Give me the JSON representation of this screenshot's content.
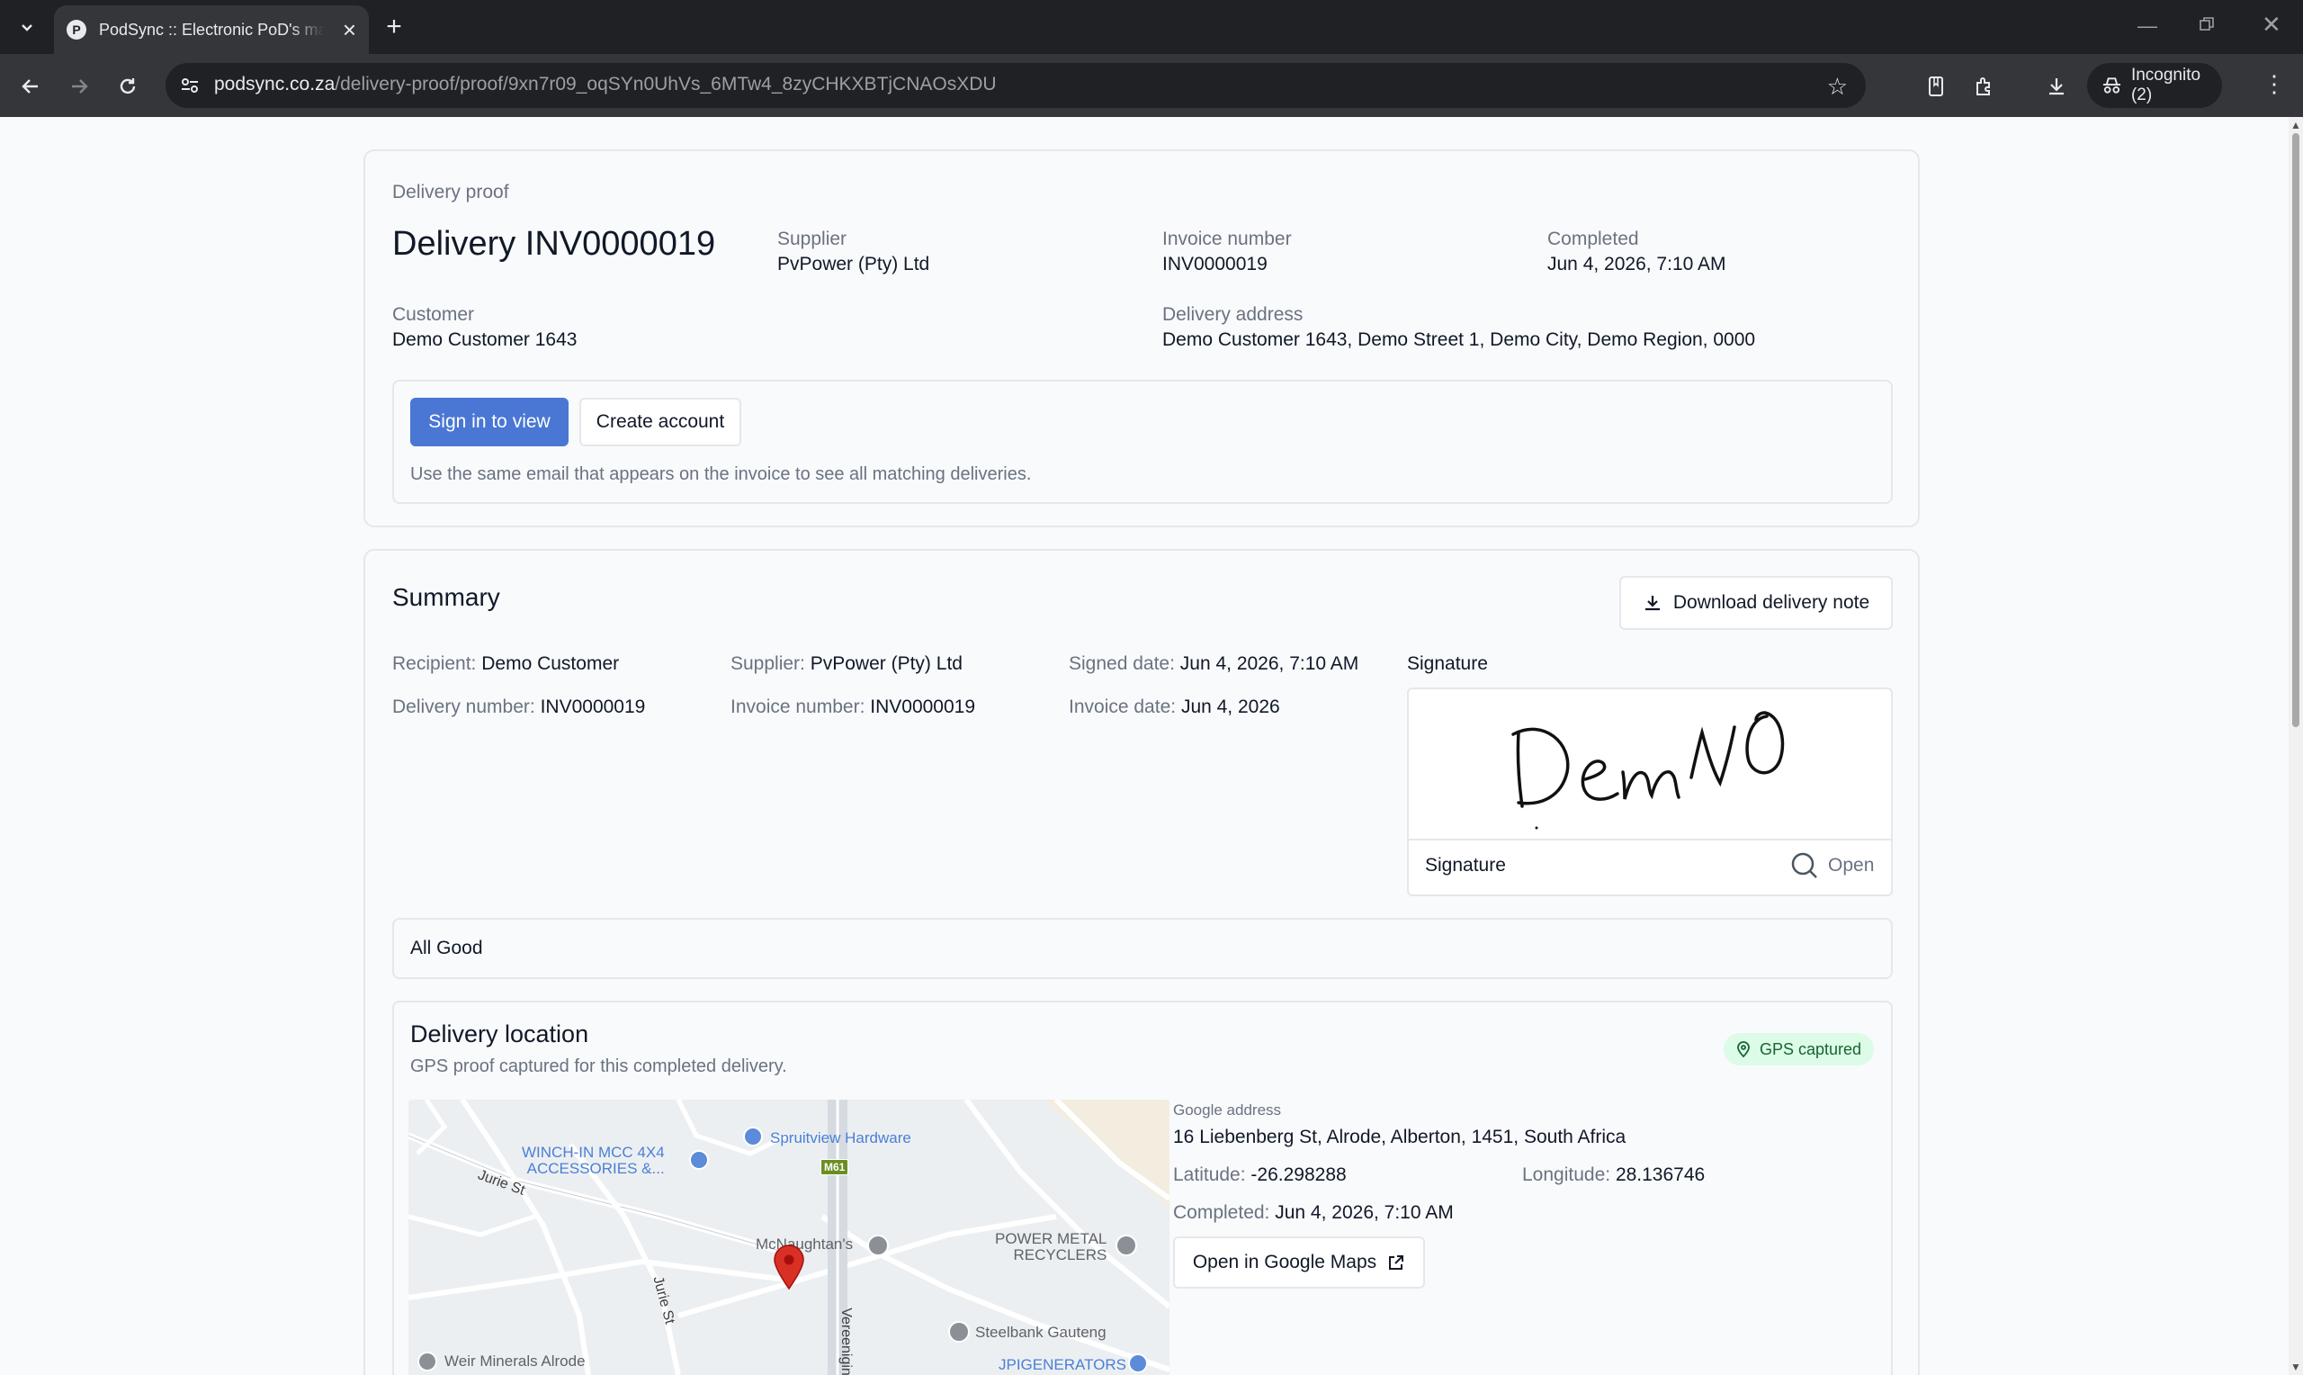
{
  "browser": {
    "tab_title": "PodSync :: Electronic PoD's made simple",
    "favicon_letter": "P",
    "url_host": "podsync.co.za",
    "url_path": "/delivery-proof/proof/9xn7r09_oqSYn0UhVs_6MTw4_8zyCHKXBTjCNAOsXDU",
    "incognito_label": "Incognito (2)"
  },
  "header_card": {
    "eyebrow": "Delivery proof",
    "title": "Delivery INV0000019",
    "supplier_label": "Supplier",
    "supplier_value": "PvPower (Pty) Ltd",
    "invoice_label": "Invoice number",
    "invoice_value": "INV0000019",
    "completed_label": "Completed",
    "completed_value": "Jun 4, 2026, 7:10 AM",
    "customer_label": "Customer",
    "customer_value": "Demo Customer 1643",
    "address_label": "Delivery address",
    "address_value": "Demo Customer 1643, Demo Street 1, Demo City, Demo Region, 0000",
    "sign_in_label": "Sign in to view",
    "create_account_label": "Create account",
    "hint": "Use the same email that appears on the invoice to see all matching deliveries."
  },
  "summary": {
    "title": "Summary",
    "download_label": "Download delivery note",
    "recipient_label": "Recipient:",
    "recipient_value": "Demo Customer",
    "supplier_label": "Supplier:",
    "supplier_value": "PvPower (Pty) Ltd",
    "signed_label": "Signed date:",
    "signed_value": "Jun 4, 2026, 7:10 AM",
    "delivery_no_label": "Delivery number:",
    "delivery_no_value": "INV0000019",
    "invoice_no_label": "Invoice number:",
    "invoice_no_value": "INV0000019",
    "invoice_date_label": "Invoice date:",
    "invoice_date_value": "Jun 4, 2026",
    "signature_heading": "Signature",
    "signature_caption": "Signature",
    "signature_open": "Open",
    "note": "All Good"
  },
  "location": {
    "title": "Delivery location",
    "subtitle": "GPS proof captured for this completed delivery.",
    "badge": "GPS captured",
    "google_address_label": "Google address",
    "google_address_value": "16 Liebenberg St, Alrode, Alberton, 1451, South Africa",
    "lat_label": "Latitude:",
    "lat_value": "-26.298288",
    "lng_label": "Longitude:",
    "lng_value": "28.136746",
    "completed_label": "Completed:",
    "completed_value": "Jun 4, 2026, 7:10 AM",
    "open_maps_label": "Open in Google Maps",
    "map": {
      "poi_winch_1": "WINCH-IN MCC 4X4",
      "poi_winch_2": "ACCESSORIES &...",
      "poi_spruitview": "Spruitview Hardware",
      "road_m61": "M61",
      "road_jurie_1": "Jurie St",
      "road_jurie_2": "Jurie St",
      "road_vereeniging": "Vereenigin",
      "poi_mcnaughtans": "McNaughtan's",
      "poi_power_1": "POWER METAL",
      "poi_power_2": "RECYCLERS",
      "poi_steelbank": "Steelbank Gauteng",
      "poi_weir": "Weir Minerals Alrode",
      "poi_jpi": "JPIGENERATORS"
    }
  },
  "colors": {
    "primary": "#4a77d4",
    "badge_bg": "#dcfce7",
    "badge_text": "#166534",
    "marker": "#d93025"
  }
}
